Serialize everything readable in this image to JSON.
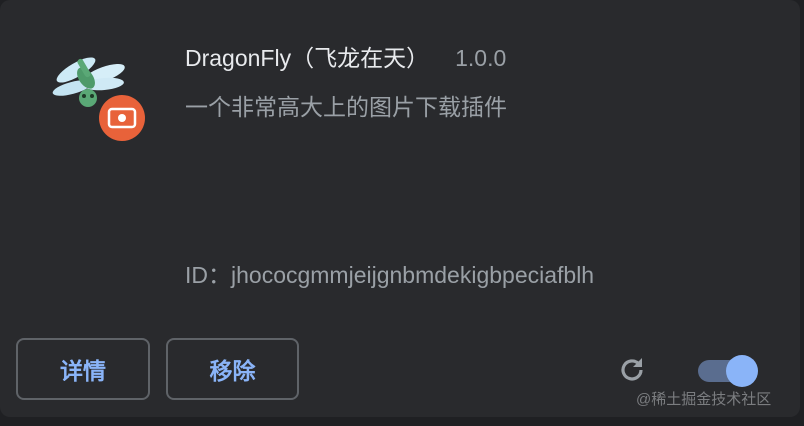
{
  "extension": {
    "name": "DragonFly（飞龙在天）",
    "version": "1.0.0",
    "description": "一个非常高大上的图片下载插件",
    "id_label": "ID：",
    "id_value": "jhococgmmjeijgnbmdekigbpeciafblh",
    "icon": "dragonfly-logo-icon",
    "badge_icon": "camera-badge-icon"
  },
  "actions": {
    "details_label": "详情",
    "remove_label": "移除",
    "reload_icon": "reload-icon"
  },
  "toggle": {
    "enabled": true,
    "track_color": "#5a6d8f",
    "knob_color": "#8ab4f8"
  },
  "watermark": "@稀土掘金技术社区",
  "colors": {
    "card_background": "#292a2d",
    "primary_text": "#e8eaed",
    "secondary_text": "#9aa0a6",
    "accent": "#8ab4f8",
    "badge": "#e8623a"
  }
}
